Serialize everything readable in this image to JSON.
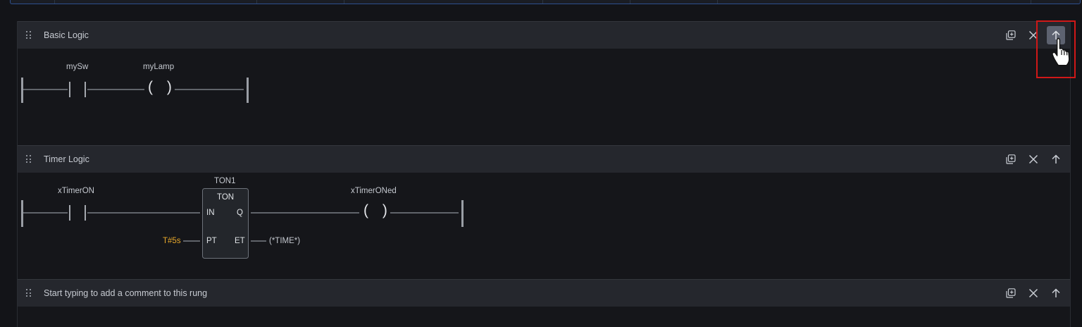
{
  "rungs": [
    {
      "title": "Basic Logic",
      "contact_label": "mySw",
      "coil_label": "myLamp",
      "coil_symbol": "( )"
    },
    {
      "title": "Timer Logic",
      "contact_label": "xTimerON",
      "block": {
        "instance": "TON1",
        "type": "TON",
        "in_pin": "IN",
        "q_pin": "Q",
        "pt_pin": "PT",
        "et_pin": "ET",
        "pt_value": "T#5s",
        "et_value": "(*TIME*)"
      },
      "coil_label": "xTimerONed",
      "coil_symbol": "( )"
    },
    {
      "title": "Start typing to add a comment to this rung"
    }
  ],
  "icons": {
    "drag": "drag-handle-icon",
    "duplicate": "duplicate-icon",
    "close": "close-icon",
    "move_up": "arrow-up-icon",
    "cursor": "hand-pointer-icon"
  },
  "colors": {
    "background": "#131418",
    "header": "#25272d",
    "wire": "#8d929a",
    "pt_value": "#e8a82b",
    "highlight": "#d01818",
    "active_button": "#5d6270"
  }
}
